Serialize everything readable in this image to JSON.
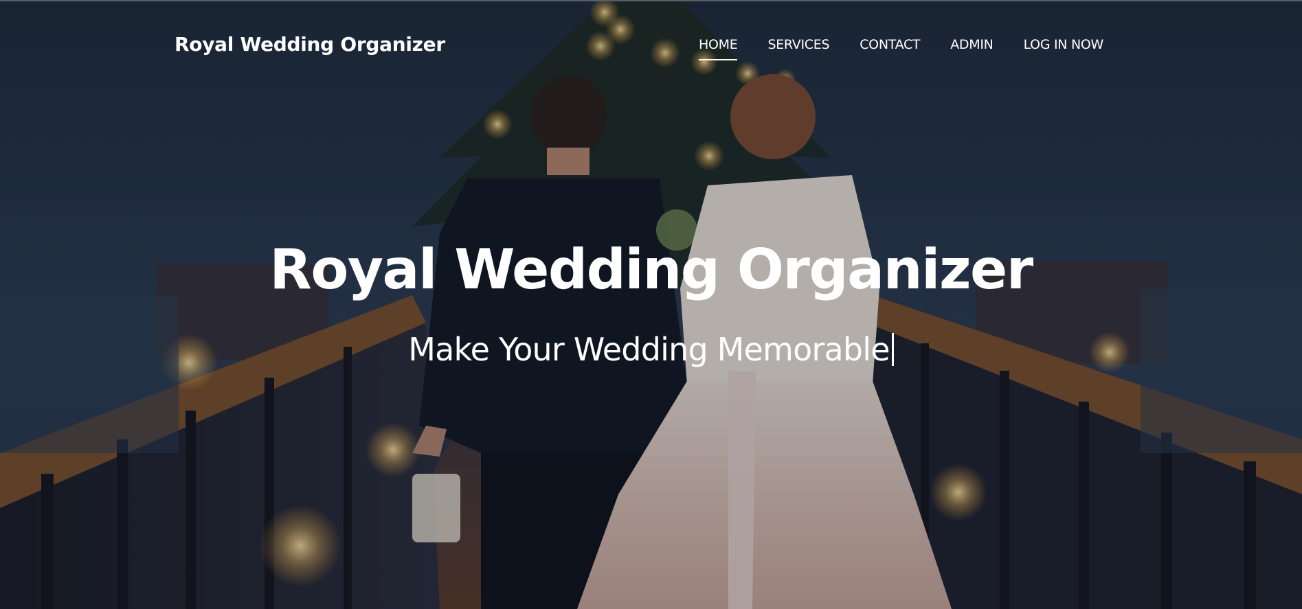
{
  "header": {
    "brand": "Royal Wedding Organizer",
    "nav": [
      {
        "label": "HOME",
        "active": true
      },
      {
        "label": "SERVICES",
        "active": false
      },
      {
        "label": "CONTACT",
        "active": false
      },
      {
        "label": "ADMIN",
        "active": false
      },
      {
        "label": "LOG IN NOW",
        "active": false
      }
    ]
  },
  "hero": {
    "title": "Royal Wedding Organizer",
    "subtitle": "Make Your Wedding Memorable",
    "background_image": "couple-walking-on-lit-pier-at-dusk",
    "colors": {
      "night_sky": "#1e2b3d",
      "lantern_glow": "#ffd27a",
      "text": "#ffffff"
    }
  }
}
